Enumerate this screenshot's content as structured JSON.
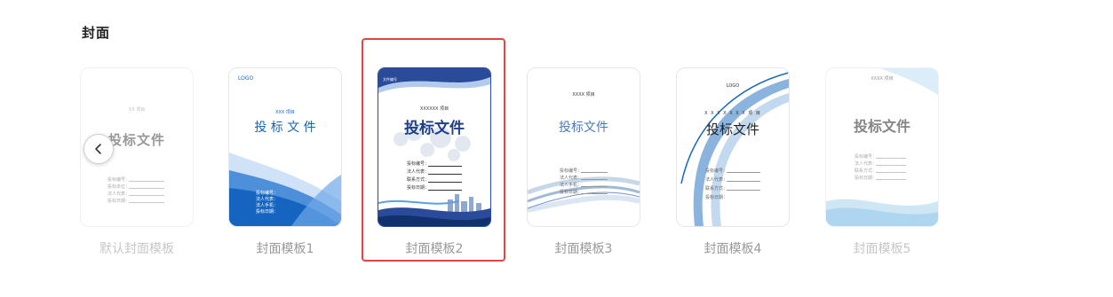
{
  "section": {
    "title": "封面"
  },
  "nav": {
    "prev_icon": "chevron-left-icon"
  },
  "colors": {
    "accent": "#1565c0",
    "selection": "#e04646",
    "selected_border": "#2a4b9a"
  },
  "templates": [
    {
      "caption": "默认封面模板",
      "project": "XX 项目",
      "title": "投标文件",
      "fields": [
        "投标编号：",
        "投标单位：",
        "法人代表：",
        "投标日期："
      ]
    },
    {
      "caption": "封面模板1",
      "logo": "LOGO",
      "project": "XXX 项目",
      "title": "投 标 文 件",
      "fields": [
        "投标编号：",
        "法人代表：",
        "法人手机：",
        "投标日期："
      ]
    },
    {
      "caption": "封面模板2",
      "logo": "文件编号",
      "project": "XXXXXX 项目",
      "title": "投标文件",
      "fields": [
        "投标编号：",
        "法人代表：",
        "联系方式：",
        "投标日期："
      ]
    },
    {
      "caption": "封面模板3",
      "project": "XXXX 项目",
      "title": "投标文件",
      "fields": [
        "投标编号：",
        "法人代表：",
        "法人手机：",
        "投标日期："
      ]
    },
    {
      "caption": "封面模板4",
      "logo": "LOGO",
      "project": "X X X X X X X 项 目",
      "title": "投标文件",
      "fields": [
        "投标编号：",
        "法人代表：",
        "联系方式：",
        "投标日期："
      ]
    },
    {
      "caption": "封面模板5",
      "project": "XXXX 项目",
      "title": "投标文件",
      "fields": [
        "投标编号：",
        "法人代表：",
        "联系方式：",
        "投标日期："
      ]
    }
  ]
}
